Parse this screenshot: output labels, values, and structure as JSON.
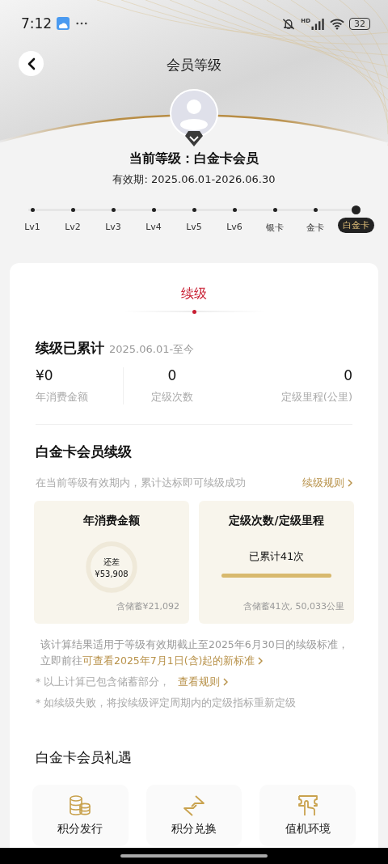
{
  "status_bar": {
    "time": "7:12",
    "signal_label": "HD",
    "battery": "32"
  },
  "header": {
    "title": "会员等级"
  },
  "member": {
    "level_text": "当前等级：白金卡会员",
    "validity": "有效期: 2025.06.01-2026.06.30"
  },
  "levels": [
    {
      "label": "Lv1",
      "selected": false
    },
    {
      "label": "Lv2",
      "selected": false
    },
    {
      "label": "Lv3",
      "selected": false
    },
    {
      "label": "Lv4",
      "selected": false
    },
    {
      "label": "Lv5",
      "selected": false
    },
    {
      "label": "Lv6",
      "selected": false
    },
    {
      "label": "银卡",
      "selected": false
    },
    {
      "label": "金卡",
      "selected": false
    },
    {
      "label": "白金卡",
      "selected": true
    }
  ],
  "tabs": [
    {
      "label": "续级",
      "selected": true
    }
  ],
  "accumulated": {
    "title": "续级已累计",
    "period": "2025.06.01-至今",
    "stats": [
      {
        "value": "¥0",
        "label": "年消费金额"
      },
      {
        "value": "0",
        "label": "定级次数"
      },
      {
        "value": "0",
        "label": "定级里程(公里)"
      }
    ]
  },
  "renewal": {
    "title": "白金卡会员续级",
    "subtitle": "在当前等级有效期内，累计达标即可续级成功",
    "rules_link": "续级规则",
    "boxes": [
      {
        "kind": "ring",
        "title": "年消费金额",
        "caption": "还差",
        "amount": "¥53,908",
        "footnote": "含储蓄¥21,092"
      },
      {
        "kind": "bar",
        "title": "定级次数/定级里程",
        "caption": "已累计41次",
        "level": 1,
        "footnote": "含储蓄41次, 50,033公里"
      }
    ],
    "note": {
      "text": "该计算结果适用于等级有效期截止至2025年6月30日的续级标准，立即前往",
      "link": "可查看2025年7月1日(含)起的新标准"
    },
    "footnotes": [
      {
        "text": "* 以上计算已包含储蓄部分，",
        "link": "查看规则"
      },
      {
        "text": "* 如续级失败，将按续级评定周期内的定级指标重新定级"
      }
    ]
  },
  "benefits": {
    "title": "白金卡会员礼遇",
    "items": [
      {
        "kind": "coins",
        "label": "积分发行"
      },
      {
        "kind": "exchange",
        "label": "积分兑换"
      },
      {
        "kind": "ticket",
        "label": "值机环境"
      }
    ]
  }
}
